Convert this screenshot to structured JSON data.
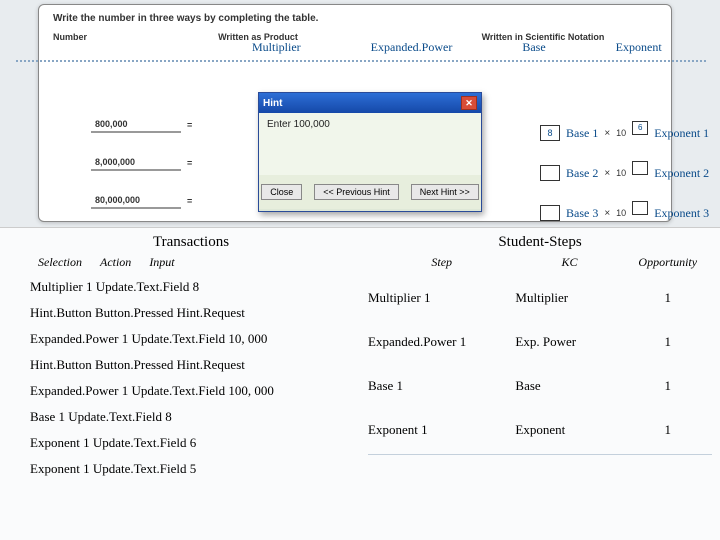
{
  "workbook": {
    "instruction": "Write the number in three ways by completing the table.",
    "headers": {
      "number": "Number",
      "product": "Written as Product",
      "sci": "Written in Scientific Notation"
    },
    "numbers": [
      "800,000",
      "8,000,000",
      "80,000,000"
    ],
    "equals": "="
  },
  "labels": {
    "multiplier": "Multiplier",
    "expanded": "Expanded.Power",
    "base": "Base",
    "exponent": "Exponent",
    "base1": "Base 1",
    "exp1": "Exponent 1",
    "base2": "Base 2",
    "exp2": "Exponent 2",
    "base3": "Base 3",
    "exp3": "Exponent 3"
  },
  "sci_values": {
    "base1": "8",
    "exp1": "6"
  },
  "hint": {
    "title": "Hint",
    "body": "Enter 100,000",
    "close": "Close",
    "prev": "<< Previous Hint",
    "next": "Next Hint >>"
  },
  "tx": {
    "title": "Transactions",
    "h_sel": "Selection",
    "h_act": "Action",
    "h_inp": "Input",
    "rows": [
      "Multiplier 1   Update.Text.Field    8",
      "Hint.Button   Button.Pressed   Hint.Request",
      "Expanded.Power 1   Update.Text.Field   10, 000",
      "Hint.Button   Button.Pressed   Hint.Request",
      "Expanded.Power 1   Update.Text.Field   100, 000",
      "Base 1   Update.Text.Field   8",
      "Exponent 1   Update.Text.Field   6",
      "Exponent 1   Update.Text.Field   5"
    ]
  },
  "steps": {
    "title": "Student-Steps",
    "h_step": "Step",
    "h_kc": "KC",
    "h_opp": "Opportunity",
    "rows": [
      {
        "step": "Multiplier 1",
        "kc": "Multiplier",
        "opp": "1"
      },
      {
        "step": "Expanded.Power 1",
        "kc": "Exp. Power",
        "opp": "1"
      },
      {
        "step": "Base 1",
        "kc": "Base",
        "opp": "1"
      },
      {
        "step": "Exponent 1",
        "kc": "Exponent",
        "opp": "1"
      }
    ]
  },
  "glyphs": {
    "times": "×",
    "ten": "10"
  }
}
